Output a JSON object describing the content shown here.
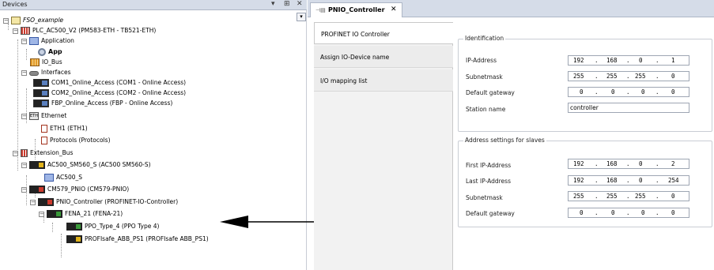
{
  "devices": {
    "title": "Devices",
    "header_buttons": [
      "▾",
      "⊞",
      "✕"
    ],
    "tree": [
      {
        "label": "FSO_example",
        "icon": "project-icon"
      },
      {
        "label": "PLC_AC500_V2 (PM583-ETH - TB521-ETH)",
        "icon": "plc-icon"
      },
      {
        "label": "Application",
        "icon": "application-icon"
      },
      {
        "label": "App",
        "icon": "gear-icon"
      },
      {
        "label": "IO_Bus",
        "icon": "io-bus-icon"
      },
      {
        "label": "Interfaces",
        "icon": "interfaces-icon"
      },
      {
        "label": "COM1_Online_Access (COM1 - Online Access)",
        "icon": "com-port-icon"
      },
      {
        "label": "COM2_Online_Access (COM2 - Online Access)",
        "icon": "com-port-icon"
      },
      {
        "label": "FBP_Online_Access (FBP - Online Access)",
        "icon": "com-port-icon"
      },
      {
        "label": "Ethernet",
        "icon": "ethernet-icon"
      },
      {
        "label": "ETH1 (ETH1)",
        "icon": "slot-icon"
      },
      {
        "label": "Protocols (Protocols)",
        "icon": "slot-icon"
      },
      {
        "label": "Extension_Bus",
        "icon": "extension-bus-icon"
      },
      {
        "label": "AC500_SM560_S (AC500 SM560-S)",
        "icon": "module-icon"
      },
      {
        "label": "AC500_S",
        "icon": "application-icon"
      },
      {
        "label": "CM579_PNIO (CM579-PNIO)",
        "icon": "module-icon"
      },
      {
        "label": "PNIO_Controller (PROFINET-IO-Controller)",
        "icon": "module-icon"
      },
      {
        "label": "FENA_21 (FENA-21)",
        "icon": "module-icon"
      },
      {
        "label": "PPO_Type_4 (PPO Type 4)",
        "icon": "module-icon"
      },
      {
        "label": "PROFIsafe_ABB_PS1 (PROFIsafe ABB_PS1)",
        "icon": "module-icon"
      }
    ]
  },
  "editor": {
    "tab_label": "PNIO_Controller",
    "side_tabs": [
      "PROFINET IO Controller",
      "Assign IO-Device name",
      "I/O mapping list"
    ],
    "identification": {
      "title": "Identification",
      "ip_address_label": "IP-Address",
      "ip_address": [
        "192",
        "168",
        "0",
        "1"
      ],
      "subnetmask_label": "Subnetmask",
      "subnetmask": [
        "255",
        "255",
        "255",
        "0"
      ],
      "gateway_label": "Default gateway",
      "gateway": [
        "0",
        "0",
        "0",
        "0"
      ],
      "station_name_label": "Station name",
      "station_name": "controller"
    },
    "slaves": {
      "title": "Address settings for slaves",
      "first_ip_label": "First IP-Address",
      "first_ip": [
        "192",
        "168",
        "0",
        "2"
      ],
      "last_ip_label": "Last IP-Address",
      "last_ip": [
        "192",
        "168",
        "0",
        "254"
      ],
      "subnetmask_label": "Subnetmask",
      "subnetmask": [
        "255",
        "255",
        "255",
        "0"
      ],
      "gateway_label": "Default gateway",
      "gateway": [
        "0",
        "0",
        "0",
        "0"
      ]
    }
  }
}
